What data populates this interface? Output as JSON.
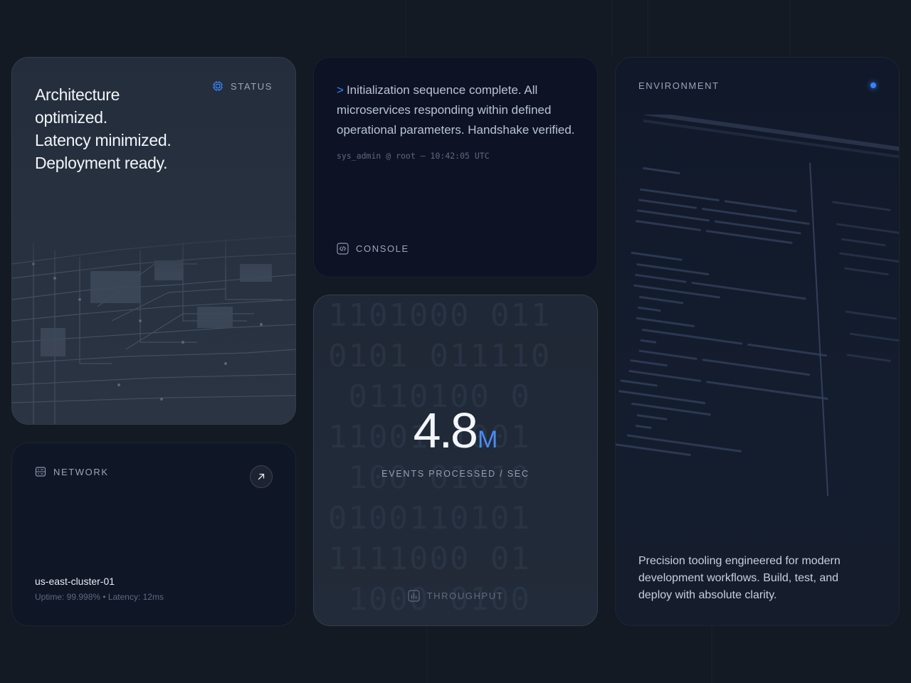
{
  "status": {
    "label": "STATUS",
    "headline": [
      "Architecture",
      "optimized.",
      "Latency minimized.",
      "Deployment ready."
    ]
  },
  "network": {
    "label": "NETWORK",
    "cluster": "us-east-cluster-01",
    "meta": "Uptime: 99.998% • Latency: 12ms"
  },
  "console": {
    "prompt": ">",
    "message": "Initialization sequence complete. All microservices responding within defined operational parameters. Handshake verified.",
    "sys": "sys_admin @ root — 10:42:05 UTC",
    "label": "CONSOLE"
  },
  "throughput": {
    "value": "4.8",
    "unit": "M",
    "caption": "EVENTS PROCESSED / SEC",
    "label": "THROUGHPUT"
  },
  "environment": {
    "label": "ENVIRONMENT",
    "description": "Precision tooling engineered for modern development workflows. Build, test, and deploy with absolute clarity."
  },
  "colors": {
    "accent": "#3b82f6",
    "background": "#141a23"
  }
}
